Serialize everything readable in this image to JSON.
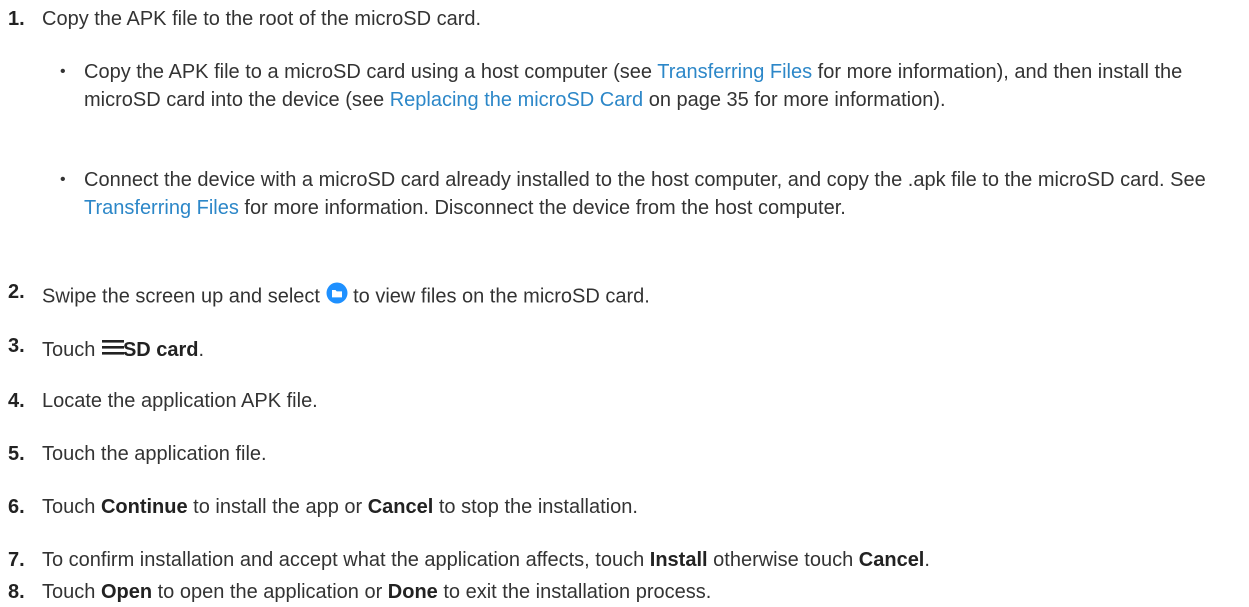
{
  "steps": [
    {
      "num": "1.",
      "text": "Copy the APK file to the root of the microSD card."
    },
    {
      "num": "2.",
      "pre": "Swipe the screen up and select",
      "post": "to view files on the microSD card.",
      "icon": "files-folder-icon"
    },
    {
      "num": "3.",
      "pre": "Touch",
      "bold": "SD card",
      "post": ".",
      "icon": "menu-icon"
    },
    {
      "num": "4.",
      "text": "Locate the application APK file."
    },
    {
      "num": "5.",
      "text": "Touch the application file."
    },
    {
      "num": "6.",
      "pre": "Touch",
      "bold1": "Continue",
      "mid": "to install the app or",
      "bold2": "Cancel",
      "post": "to stop the installation."
    },
    {
      "num": "7.",
      "pre": "To confirm installation and accept what the application affects, touch",
      "bold1": "Install",
      "mid": "otherwise touch",
      "bold2": "Cancel",
      "post": "."
    },
    {
      "num": "8.",
      "pre": "Touch",
      "bold1": "Open",
      "mid": "to open the application or",
      "bold2": "Done",
      "post": "to exit the installation process."
    }
  ],
  "bullets": [
    {
      "dot": "•",
      "a": "Copy the APK file to a microSD card using a host computer (see",
      "link1": "Transferring Files",
      "b": "for more information), and then install the microSD card into the device (see",
      "link2": "Replacing the microSD Card",
      "c": "on page 35 for more information)."
    },
    {
      "dot": "•",
      "a": "Connect the device with a microSD card already installed to the host computer, and copy the .apk file to the microSD card. See",
      "link1": "Transferring Files",
      "b": "for more information. Disconnect the device from the host computer."
    }
  ],
  "colors": {
    "text": "#333333",
    "link": "#2c87c8",
    "icon_blue": "#1e90ff"
  }
}
